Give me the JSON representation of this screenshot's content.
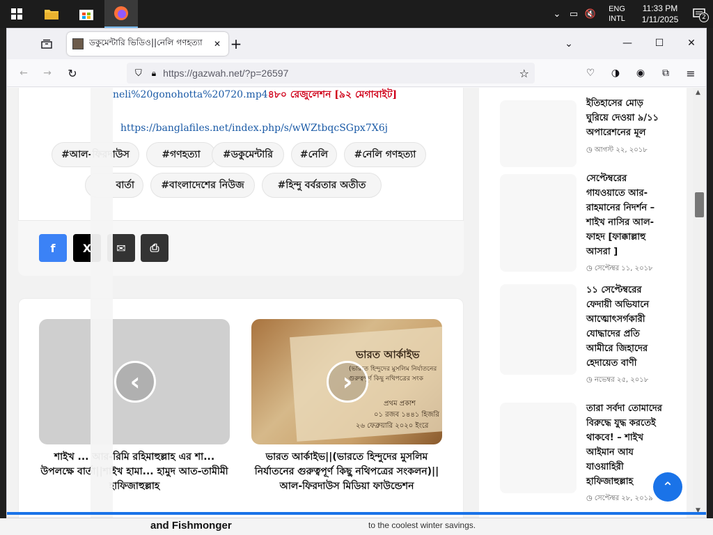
{
  "taskbar": {
    "language": [
      "ENG",
      "INTL"
    ],
    "time": "11:33 PM",
    "date": "1/11/2025",
    "notification_count": "2"
  },
  "browser": {
    "tab_title": "ডকুমেন্টারি ভিডিও||নেলি গণহত্যা",
    "url": "https://gazwah.net/?p=26597"
  },
  "article": {
    "download_link": "neli%20gonohotta%20720.mp4",
    "download_note": "৪৮০ রেজুলেশন [৯২ মেগাবাইট]",
    "alt_link": "https://banglafiles.net/index.php/s/wWZtbqcSGpx7X6j",
    "tags_row1": [
      "#আল-ফিরদাউস",
      "#গণহত্যা",
      "#ডকুমেন্টারি",
      "#নেলি",
      "#নেলি গণহত্যা"
    ],
    "tags_row2": [
      "বার্তা",
      "#বাংলাদেশের নিউজ",
      "#হিন্দু বর্বরতার অতীত"
    ]
  },
  "related": [
    {
      "title": "শাইখ ... আর-রিমি রহিমাহুল্লাহ এর শা... উপলক্ষে বার্তা||শাইখ হামা... হামুদ আত-তামীমী হাফিজাহুল্লাহ"
    },
    {
      "title": "ভারত আর্কাইভ||(ভারতে হিন্দুদের মুসলিম নির্যাতনের গুরুত্বপূর্ণ কিছু নথিপত্রের সংকলন)||আল-ফিরদাউস মিডিয়া ফাউন্ডেশন",
      "image_text": [
        "ভারত আর্কাইভ",
        "(ভারতে হিন্দুদের মুসলিম নির্যাতনের",
        "গুরুত্বপূর্ণ কিছু নথিপত্রের সংক",
        "প্রথম প্রকাশ",
        "০১ রজব ১৪৪১ হিজরি",
        "২৬ ফেব্রুয়ারি ২০২০ ইংরে"
      ]
    }
  ],
  "sidebar": [
    {
      "title": "ইতিহাসের মোড় ঘুরিয়ে দেওয়া ৯/১১ অপারেশনের মূল",
      "date": "আগস্ট ২২, ২০১৮"
    },
    {
      "title": "সেপ্টেম্বরের গাযওয়াতে আর-রাহমানের নিদর্শন – শাইখ নাসির আল-ফাহদ [ফাক্কাল্লাহু আসরা ]",
      "date": "সেপ্টেম্বর ১১, ২০১৮"
    },
    {
      "title": "১১ সেপ্টেম্বরের ফেদায়ী অভিযানে আত্মোৎসর্গকারী যোদ্ধাদের প্রতি আমীরে জিহাদের হেদায়েত বাণী",
      "date": "নভেম্বর ২৫, ২০১৮"
    },
    {
      "title": "তারা সর্বদা তোমাদের বিরুদ্ধে যুদ্ধ করতেই থাকবে! – শাইখ আইমান আয যাওয়াহিরী হাফিজাহুল্লাহ",
      "date": "সেপ্টেম্বর ২৮, ২০১৯"
    }
  ],
  "behind_text": [
    "and Fishmonger",
    "to the coolest winter savings."
  ]
}
